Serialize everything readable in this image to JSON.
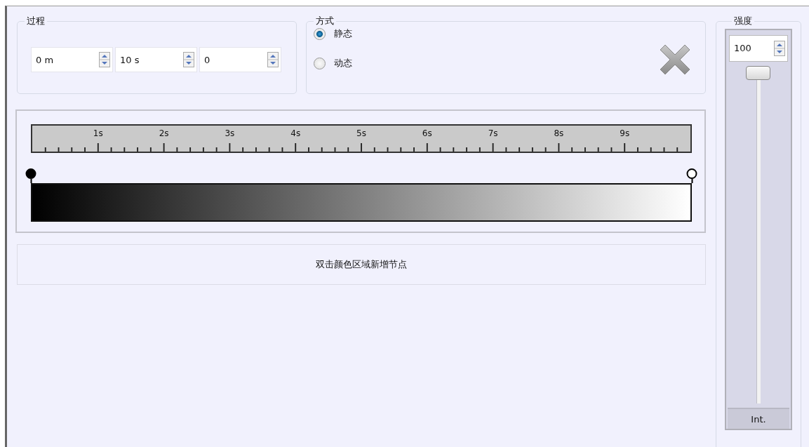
{
  "process": {
    "title": "过程",
    "fields": [
      {
        "value": "0 m"
      },
      {
        "value": "10 s"
      },
      {
        "value": "0"
      }
    ]
  },
  "mode": {
    "title": "方式",
    "options": [
      {
        "label": "静态",
        "selected": true
      },
      {
        "label": "动态",
        "selected": false
      }
    ]
  },
  "timeline": {
    "ruler_labels": [
      "1s",
      "2s",
      "3s",
      "4s",
      "5s",
      "6s",
      "7s",
      "8s",
      "9s"
    ],
    "stops": [
      {
        "color": "#000000"
      },
      {
        "color": "#ffffff"
      }
    ]
  },
  "hint": "双击颜色区域新增节点",
  "intensity": {
    "title": "强度",
    "value": "100",
    "level": 1,
    "label": "Int."
  }
}
